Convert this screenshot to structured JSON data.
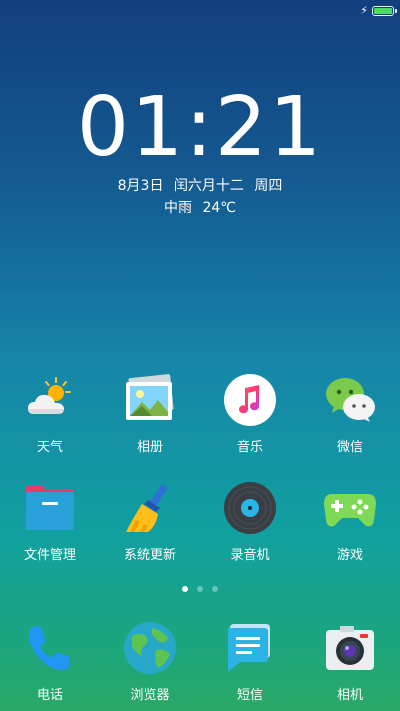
{
  "status_bar": {
    "charging_icon": "bolt-icon",
    "battery_level": 1.0,
    "battery_color": "#4cd964"
  },
  "lockclock": {
    "time": "01:21",
    "date": "8月3日",
    "lunar": "闰六月十二",
    "weekday": "周四",
    "weather": "中雨",
    "temperature": "24℃"
  },
  "apps": [
    {
      "label": "天气",
      "icon": "weather-icon"
    },
    {
      "label": "相册",
      "icon": "gallery-icon"
    },
    {
      "label": "音乐",
      "icon": "music-icon"
    },
    {
      "label": "微信",
      "icon": "wechat-icon"
    },
    {
      "label": "文件管理",
      "icon": "folder-icon"
    },
    {
      "label": "系统更新",
      "icon": "broom-icon"
    },
    {
      "label": "录音机",
      "icon": "recorder-icon"
    },
    {
      "label": "游戏",
      "icon": "gamepad-icon"
    }
  ],
  "pager": {
    "pages": 3,
    "current": 1
  },
  "dock": [
    {
      "label": "电话",
      "icon": "phone-icon"
    },
    {
      "label": "浏览器",
      "icon": "browser-icon"
    },
    {
      "label": "短信",
      "icon": "messages-icon"
    },
    {
      "label": "相机",
      "icon": "camera-icon"
    }
  ]
}
